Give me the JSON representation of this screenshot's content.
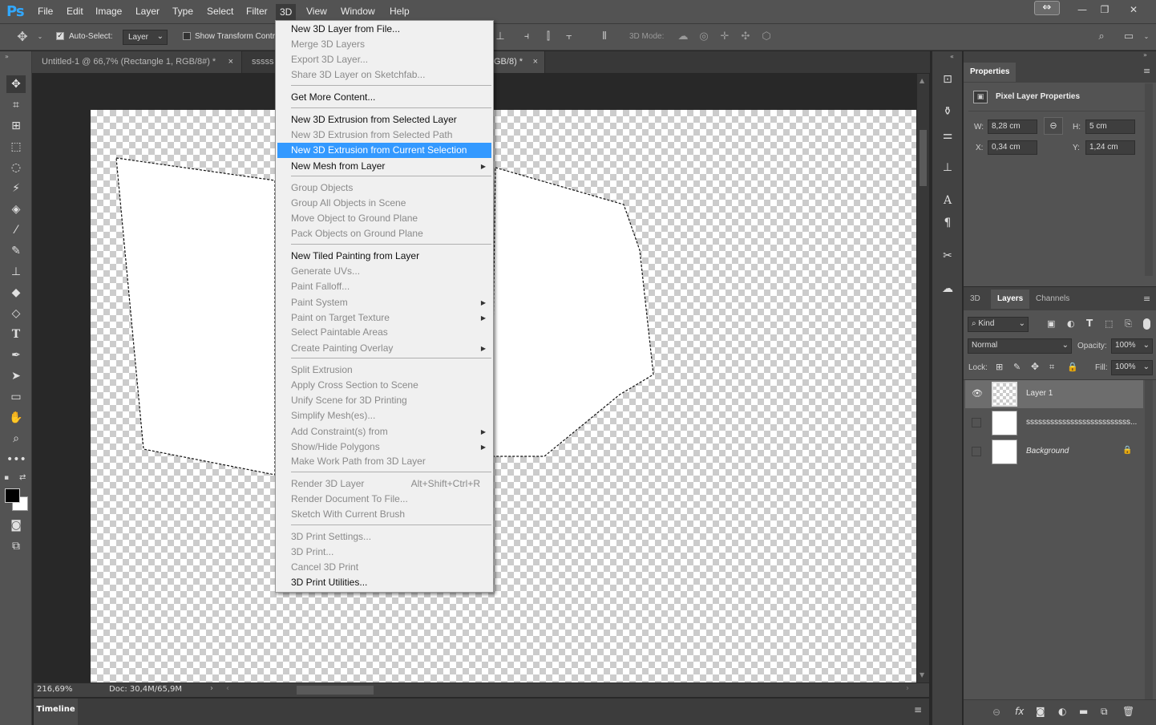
{
  "app": {
    "logo": "Ps"
  },
  "menubar": {
    "items": [
      "File",
      "Edit",
      "Image",
      "Layer",
      "Type",
      "Select",
      "Filter",
      "3D",
      "View",
      "Window",
      "Help"
    ],
    "window_controls": [
      "—",
      "❐",
      "✕"
    ]
  },
  "options": {
    "auto_select_label": "Auto-Select:",
    "auto_select_checked": true,
    "auto_select_value": "Layer",
    "show_transform_label": "Show Transform Contr",
    "mode3d_label": "3D Mode:"
  },
  "tabs": [
    {
      "label": "Untitled-1 @ 66,7% (Rectangle 1, RGB/8#) *",
      "close": "×"
    },
    {
      "label": "sssss",
      "close": ""
    },
    {
      "label": "GB/8) *",
      "close": "×"
    }
  ],
  "menu3d": {
    "items": [
      {
        "label": "New 3D Layer from File...",
        "enabled": true
      },
      {
        "label": "Merge 3D Layers",
        "enabled": false
      },
      {
        "label": "Export 3D Layer...",
        "enabled": false
      },
      {
        "label": "Share 3D Layer on Sketchfab...",
        "enabled": false
      },
      {
        "sep": true
      },
      {
        "label": "Get More Content...",
        "enabled": true
      },
      {
        "sep": true
      },
      {
        "label": "New 3D Extrusion from Selected Layer",
        "enabled": true
      },
      {
        "label": "New 3D Extrusion from Selected Path",
        "enabled": false
      },
      {
        "label": "New 3D Extrusion from Current Selection",
        "enabled": true,
        "highlighted": true
      },
      {
        "label": "New Mesh from Layer",
        "enabled": true,
        "submenu": true
      },
      {
        "sep": true
      },
      {
        "label": "Group Objects",
        "enabled": false
      },
      {
        "label": "Group All Objects in Scene",
        "enabled": false
      },
      {
        "label": "Move Object to Ground Plane",
        "enabled": false
      },
      {
        "label": "Pack Objects on Ground Plane",
        "enabled": false
      },
      {
        "sep": true
      },
      {
        "label": "New Tiled Painting from Layer",
        "enabled": true
      },
      {
        "label": "Generate UVs...",
        "enabled": false
      },
      {
        "label": "Paint Falloff...",
        "enabled": false
      },
      {
        "label": "Paint System",
        "enabled": false,
        "submenu": true
      },
      {
        "label": "Paint on Target Texture",
        "enabled": false,
        "submenu": true
      },
      {
        "label": "Select Paintable Areas",
        "enabled": false
      },
      {
        "label": "Create Painting Overlay",
        "enabled": false,
        "submenu": true
      },
      {
        "sep": true
      },
      {
        "label": "Split Extrusion",
        "enabled": false
      },
      {
        "label": "Apply Cross Section to Scene",
        "enabled": false
      },
      {
        "label": "Unify Scene for 3D Printing",
        "enabled": false
      },
      {
        "label": "Simplify Mesh(es)...",
        "enabled": false
      },
      {
        "label": "Add Constraint(s) from",
        "enabled": false,
        "submenu": true
      },
      {
        "label": "Show/Hide Polygons",
        "enabled": false,
        "submenu": true
      },
      {
        "label": "Make Work Path from 3D Layer",
        "enabled": false
      },
      {
        "sep": true
      },
      {
        "label": "Render 3D Layer",
        "enabled": false,
        "shortcut": "Alt+Shift+Ctrl+R"
      },
      {
        "label": "Render Document To File...",
        "enabled": false
      },
      {
        "label": "Sketch With Current Brush",
        "enabled": false
      },
      {
        "sep": true
      },
      {
        "label": "3D Print Settings...",
        "enabled": false
      },
      {
        "label": "3D Print...",
        "enabled": false
      },
      {
        "label": "Cancel 3D Print",
        "enabled": false
      },
      {
        "label": "3D Print Utilities...",
        "enabled": true
      }
    ]
  },
  "status": {
    "zoom": "216,69%",
    "doc": "Doc: 30,4M/65,9M"
  },
  "timeline": {
    "label": "Timeline"
  },
  "properties": {
    "title": "Properties",
    "subtitle": "Pixel Layer Properties",
    "w_label": "W:",
    "w_value": "8,28 cm",
    "h_label": "H:",
    "h_value": "5 cm",
    "x_label": "X:",
    "x_value": "0,34 cm",
    "y_label": "Y:",
    "y_value": "1,24 cm"
  },
  "layers_panel": {
    "tabs": [
      "3D",
      "Layers",
      "Channels"
    ],
    "active_tab": "Layers",
    "kind_label": "Kind",
    "blend_mode": "Normal",
    "opacity_label": "Opacity:",
    "opacity_value": "100%",
    "lock_label": "Lock:",
    "fill_label": "Fill:",
    "fill_value": "100%",
    "layers": [
      {
        "name": "Layer 1",
        "visible": true,
        "selected": true
      },
      {
        "name": "ssssssssssssssssssssssssss...",
        "visible": false,
        "selected": false
      },
      {
        "name": "Background",
        "visible": false,
        "selected": false,
        "locked": true
      }
    ]
  },
  "colors": {
    "accent": "#3399ff",
    "panel": "#535353",
    "dark": "#282828"
  }
}
